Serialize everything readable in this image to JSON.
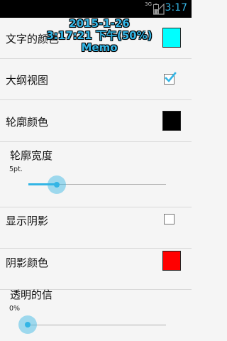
{
  "status_bar": {
    "network": "3G",
    "time": "3:17"
  },
  "overlay": {
    "date": "2015-1-26",
    "time": "3:17:21 下午(50%)",
    "app": "Memo"
  },
  "settings": {
    "text_color": {
      "label": "文字的颜色",
      "color": "#00ffff"
    },
    "outline_view": {
      "label": "大纲视图",
      "checked": true
    },
    "outline_color": {
      "label": "轮廓颜色",
      "color": "#000000"
    },
    "outline_width": {
      "title": "轮廓宽度",
      "value": "5pt.",
      "level_percent": 22
    },
    "show_shadow": {
      "label": "显示阴影",
      "checked": false
    },
    "shadow_color": {
      "label": "阴影颜色",
      "color": "#ff0000"
    },
    "transparency": {
      "title": "透明的信",
      "value": "0%",
      "level_percent": 0
    }
  },
  "colors": {
    "accent": "#33b5e5",
    "background": "#f5f5f5",
    "divider": "#d9d9d9"
  }
}
